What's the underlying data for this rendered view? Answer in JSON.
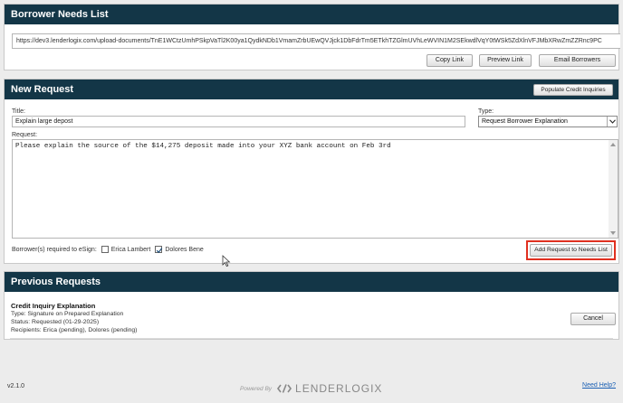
{
  "needs_list": {
    "title": "Borrower Needs List",
    "url": "https://dev3.lenderlogix.com/upload-documents/TnE1WCtzUmhPSkpVaTl2K00ya1QydkNDb1VmamZrbUEwQVJjck1DbFdrTm5ETkhTZGlmUVhLeWVIN1M2SEkwdlVqY0tWSk5ZdXlnVFJMbXRwZmZZRnc9PC",
    "buttons": {
      "copy": "Copy Link",
      "preview": "Preview Link",
      "email": "Email Borrowers"
    }
  },
  "new_request": {
    "title": "New Request",
    "populate_button": "Populate Credit Inquiries",
    "title_label": "Title:",
    "title_value": "Explain large depost",
    "type_label": "Type:",
    "type_value": "Request Borrower Explanation",
    "request_label": "Request:",
    "request_value": "Please explain the source of the $14,275 deposit made into your XYZ bank account on Feb 3rd",
    "esign_label": "Borrower(s) required to eSign:",
    "borrowers": [
      {
        "name": "Erica Lambert",
        "checked": false
      },
      {
        "name": "Dolores Bene",
        "checked": true
      }
    ],
    "add_button": "Add Request to Needs List"
  },
  "previous_requests": {
    "title": "Previous Requests",
    "items": [
      {
        "name": "Credit Inquiry Explanation",
        "type": "Type: Signature on Prepared Explanation",
        "status": "Status: Requested (01-29-2025)",
        "recipients": "Recipients: Erica (pending), Dolores (pending)",
        "cancel_label": "Cancel"
      }
    ]
  },
  "footer": {
    "version": "v2.1.0",
    "powered_by": "Powered By",
    "brand": "LENDERLOGIX",
    "help": "Need Help?"
  },
  "colors": {
    "header_bg": "#133647",
    "highlight": "#e03020",
    "link": "#1a5fb4"
  }
}
